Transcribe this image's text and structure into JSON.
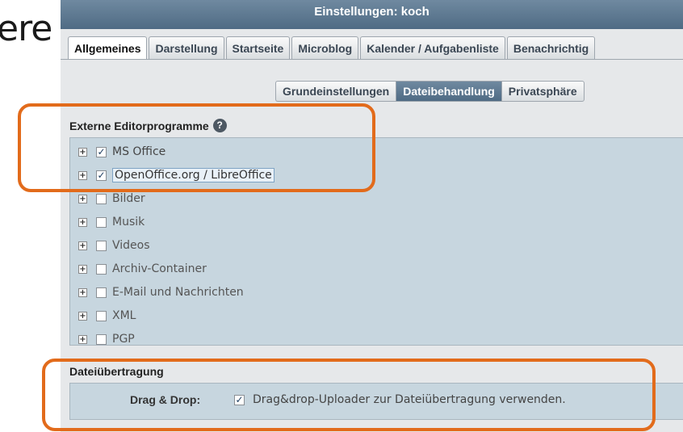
{
  "background_text": "ere",
  "window": {
    "title": "Einstellungen: koch"
  },
  "tabs": [
    {
      "label": "Allgemeines",
      "active": true
    },
    {
      "label": "Darstellung",
      "active": false
    },
    {
      "label": "Startseite",
      "active": false
    },
    {
      "label": "Microblog",
      "active": false
    },
    {
      "label": "Kalender / Aufgabenliste",
      "active": false
    },
    {
      "label": "Benachrichtig",
      "active": false
    }
  ],
  "subtabs": [
    {
      "label": "Grundeinstellungen",
      "active": false
    },
    {
      "label": "Dateibehandlung",
      "active": true
    },
    {
      "label": "Privatsphäre",
      "active": false
    }
  ],
  "editors": {
    "title": "Externe Editorprogramme",
    "help_icon": "question-circle-icon",
    "items": [
      {
        "label": "MS Office",
        "checked": true
      },
      {
        "label": "OpenOffice.org / LibreOffice",
        "checked": true,
        "highlighted": true
      },
      {
        "label": "Bilder",
        "checked": false
      },
      {
        "label": "Musik",
        "checked": false
      },
      {
        "label": "Videos",
        "checked": false
      },
      {
        "label": "Archiv-Container",
        "checked": false
      },
      {
        "label": "E-Mail und Nachrichten",
        "checked": false
      },
      {
        "label": "XML",
        "checked": false
      },
      {
        "label": "PGP",
        "checked": false
      }
    ]
  },
  "transfer": {
    "title": "Dateiübertragung",
    "drag_drop_label": "Drag & Drop:",
    "drag_drop_checked": true,
    "drag_drop_text": "Drag&drop-Uploader zur Dateiübertragung verwenden."
  },
  "colors": {
    "accent": "#4f6b84",
    "callout": "#e26b1b",
    "panel": "#c7d6df"
  }
}
